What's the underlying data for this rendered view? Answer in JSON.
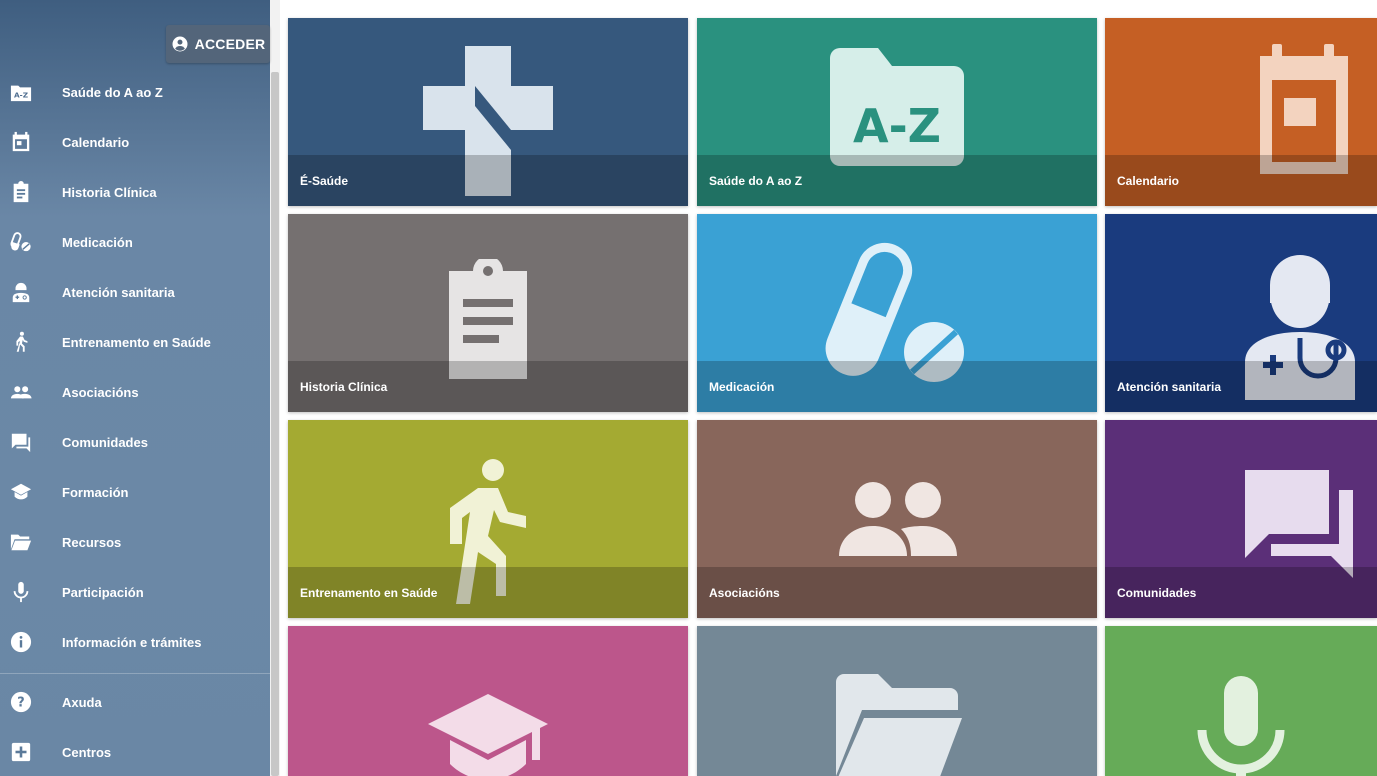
{
  "header": {
    "login_label": "ACCEDER",
    "login_icon": "account-circle-icon"
  },
  "sidebar": {
    "items": [
      {
        "label": "Saúde do A ao Z",
        "icon": "az-icon"
      },
      {
        "label": "Calendario",
        "icon": "calendar-icon"
      },
      {
        "label": "Historia Clínica",
        "icon": "clipboard-icon"
      },
      {
        "label": "Medicación",
        "icon": "pills-icon"
      },
      {
        "label": "Atención sanitaria",
        "icon": "doctor-icon"
      },
      {
        "label": "Entrenamento en Saúde",
        "icon": "walking-icon"
      },
      {
        "label": "Asociacións",
        "icon": "people-icon"
      },
      {
        "label": "Comunidades",
        "icon": "chat-icon"
      },
      {
        "label": "Formación",
        "icon": "graduation-cap-icon"
      },
      {
        "label": "Recursos",
        "icon": "folder-open-icon"
      },
      {
        "label": "Participación",
        "icon": "microphone-icon"
      },
      {
        "label": "Información e trámites",
        "icon": "info-icon"
      },
      {
        "label": "Axuda",
        "icon": "help-icon"
      },
      {
        "label": "Centros",
        "icon": "hospital-plus-icon"
      }
    ]
  },
  "tiles": [
    {
      "label": "É-Saúde",
      "color": "#36587d",
      "icon": "e-saude-cross-icon"
    },
    {
      "label": "Saúde do A ao Z",
      "color": "#2a917f",
      "icon": "az-folder-icon",
      "icon_text": "A-Z"
    },
    {
      "label": "Calendario",
      "color": "#c55f24",
      "icon": "calendar-icon"
    },
    {
      "label": "Historia Clínica",
      "color": "#757070",
      "icon": "clipboard-icon"
    },
    {
      "label": "Medicación",
      "color": "#3aa1d4",
      "icon": "pills-icon"
    },
    {
      "label": "Atención sanitaria",
      "color": "#1a3b7e",
      "icon": "doctor-icon"
    },
    {
      "label": "Entrenamento en Saúde",
      "color": "#a4aa32",
      "icon": "walking-icon"
    },
    {
      "label": "Asociacións",
      "color": "#88665b",
      "icon": "people-icon"
    },
    {
      "label": "Comunidades",
      "color": "#5b2f78",
      "icon": "chat-icon"
    },
    {
      "label": "",
      "color": "#bc568b",
      "icon": "graduation-cap-icon"
    },
    {
      "label": "",
      "color": "#748896",
      "icon": "folder-open-icon"
    },
    {
      "label": "",
      "color": "#66ab58",
      "icon": "microphone-icon"
    }
  ]
}
